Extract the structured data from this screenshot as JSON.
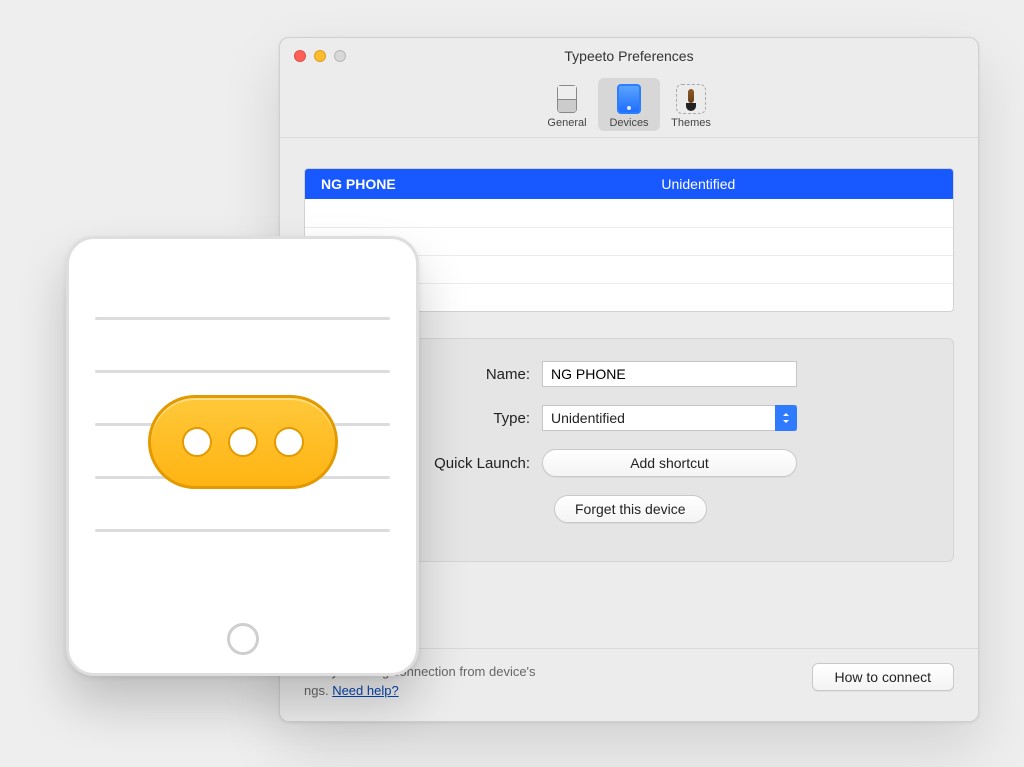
{
  "window": {
    "title": "Typeeto Preferences"
  },
  "toolbar": {
    "general": "General",
    "devices": "Devices",
    "themes": "Themes",
    "selected": "devices"
  },
  "devices": {
    "header_name": "NG PHONE",
    "header_type": "Unidentified"
  },
  "detail": {
    "name_label": "Name:",
    "name_value": "NG PHONE",
    "type_label": "Type:",
    "type_value": "Unidentified",
    "quick_launch_label": "Quick Launch:",
    "add_shortcut": "Add shortcut",
    "forget": "Forget this device"
  },
  "footer": {
    "hint_line1": "ice by initiating connection from device's",
    "hint_line2_prefix": "ngs. ",
    "need_help": "Need help?",
    "how_to_connect": "How to connect"
  }
}
